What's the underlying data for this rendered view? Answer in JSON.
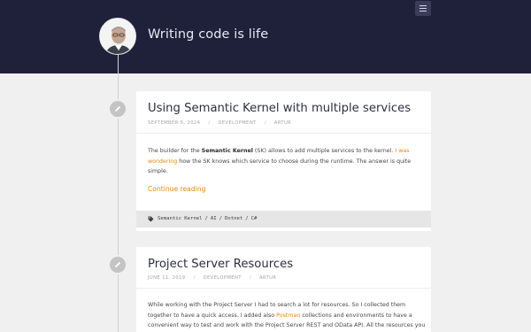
{
  "site": {
    "title": "Writing code is life"
  },
  "menu": {
    "icon": "hamburger-menu-icon"
  },
  "posts": [
    {
      "title": "Using Semantic Kernel with multiple services",
      "date": "SEPTEMBER 5, 2024",
      "category": "DEVELOPMENT",
      "author": "ARTUR",
      "excerpt": {
        "p1_a": "The builder for the ",
        "p1_b": "Semantic Kernel",
        "p1_c": " (SK) allows to add multiple services to the kernel. ",
        "p1_link": "I was wondering",
        "p1_d": " how the SK knows which service to choose during the runtime. The answer is quite simple."
      },
      "continue_label": "Continue reading",
      "tags": [
        "Semantic Kernel",
        "AI",
        "Dotnet",
        "C#"
      ]
    },
    {
      "title": "Project Server Resources",
      "date": "JUNE 11, 2019",
      "category": "DEVELOPMENT",
      "author": "ARTUR",
      "excerpt": {
        "line1": "While working with the Project Server I had to search a lot for resources. So I collected them",
        "line2_a": "together to have a quick access. I added also ",
        "line2_link": "Postman",
        "line2_b": " collections and environments to have a",
        "line3": "convenient way to test and work with the Project Server REST and OData API. All the resources you"
      }
    }
  ],
  "colors": {
    "header_bg": "#1f2039",
    "accent": "#e7870e",
    "page_bg": "#f0f0f0"
  }
}
